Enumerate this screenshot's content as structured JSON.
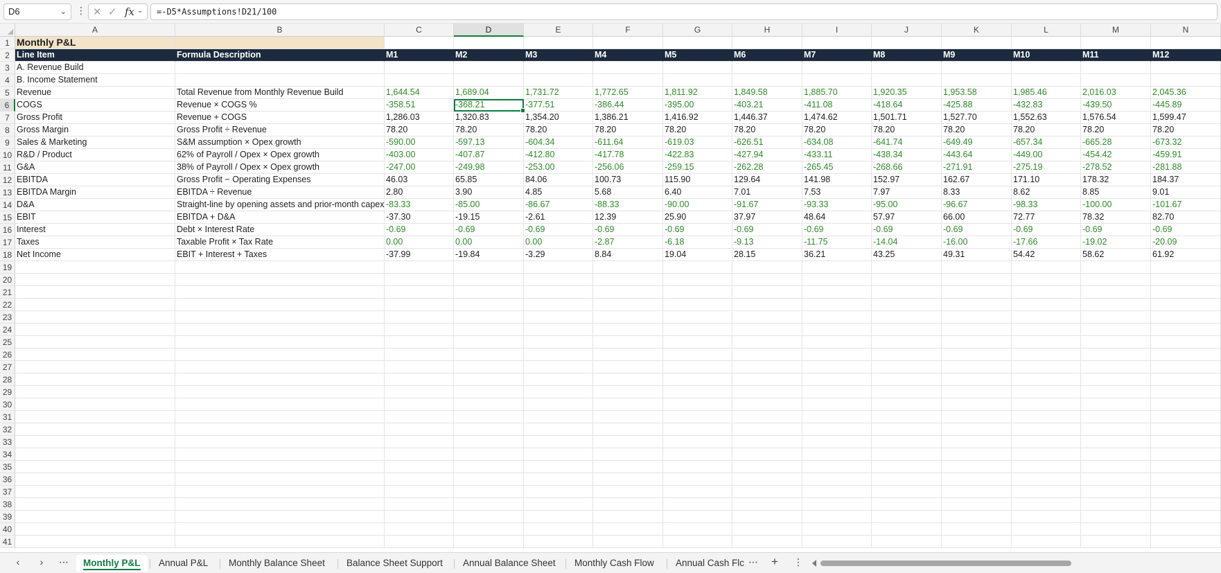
{
  "formula_bar": {
    "cell_ref": "D6",
    "formula": "=-D5*Assumptions!D21/100",
    "fx_label": "fx"
  },
  "columns": [
    "A",
    "B",
    "C",
    "D",
    "E",
    "F",
    "G",
    "H",
    "I",
    "J",
    "K",
    "L",
    "M",
    "N"
  ],
  "selected_cell": {
    "col": "D",
    "row": 6
  },
  "title": "Monthly P&L",
  "header": [
    "Line Item",
    "Formula Description",
    "M1",
    "M2",
    "M3",
    "M4",
    "M5",
    "M6",
    "M7",
    "M8",
    "M9",
    "M10",
    "M11",
    "M12"
  ],
  "rows": [
    {
      "label": "A. Revenue Build",
      "desc": "",
      "values": [],
      "green": false
    },
    {
      "label": "B. Income Statement",
      "desc": "",
      "values": [],
      "green": false
    },
    {
      "label": "Revenue",
      "desc": "Total Revenue from Monthly Revenue Build",
      "values": [
        "1,644.54",
        "1,689.04",
        "1,731.72",
        "1,772.65",
        "1,811.92",
        "1,849.58",
        "1,885.70",
        "1,920.35",
        "1,953.58",
        "1,985.46",
        "2,016.03",
        "2,045.36"
      ],
      "green": true
    },
    {
      "label": "COGS",
      "desc": "Revenue × COGS %",
      "values": [
        "-358.51",
        "-368.21",
        "-377.51",
        "-386.44",
        "-395.00",
        "-403.21",
        "-411.08",
        "-418.64",
        "-425.88",
        "-432.83",
        "-439.50",
        "-445.89"
      ],
      "green": true
    },
    {
      "label": "Gross Profit",
      "desc": "Revenue + COGS",
      "values": [
        "1,286.03",
        "1,320.83",
        "1,354.20",
        "1,386.21",
        "1,416.92",
        "1,446.37",
        "1,474.62",
        "1,501.71",
        "1,527.70",
        "1,552.63",
        "1,576.54",
        "1,599.47"
      ],
      "green": false
    },
    {
      "label": "Gross Margin",
      "desc": "Gross Profit ÷ Revenue",
      "values": [
        "78.20",
        "78.20",
        "78.20",
        "78.20",
        "78.20",
        "78.20",
        "78.20",
        "78.20",
        "78.20",
        "78.20",
        "78.20",
        "78.20"
      ],
      "green": false
    },
    {
      "label": "Sales & Marketing",
      "desc": "S&M assumption × Opex growth",
      "values": [
        "-590.00",
        "-597.13",
        "-604.34",
        "-611.64",
        "-619.03",
        "-626.51",
        "-634.08",
        "-641.74",
        "-649.49",
        "-657.34",
        "-665.28",
        "-673.32"
      ],
      "green": true
    },
    {
      "label": "R&D / Product",
      "desc": "62% of Payroll / Opex × Opex growth",
      "values": [
        "-403.00",
        "-407.87",
        "-412.80",
        "-417.78",
        "-422.83",
        "-427.94",
        "-433.11",
        "-438.34",
        "-443.64",
        "-449.00",
        "-454.42",
        "-459.91"
      ],
      "green": true
    },
    {
      "label": "G&A",
      "desc": "38% of Payroll / Opex × Opex growth",
      "values": [
        "-247.00",
        "-249.98",
        "-253.00",
        "-256.06",
        "-259.15",
        "-262.28",
        "-265.45",
        "-268.66",
        "-271.91",
        "-275.19",
        "-278.52",
        "-281.88"
      ],
      "green": true
    },
    {
      "label": "EBITDA",
      "desc": "Gross Profit − Operating Expenses",
      "values": [
        "46.03",
        "65.85",
        "84.06",
        "100.73",
        "115.90",
        "129.64",
        "141.98",
        "152.97",
        "162.67",
        "171.10",
        "178.32",
        "184.37"
      ],
      "green": false
    },
    {
      "label": "EBITDA Margin",
      "desc": "EBITDA ÷ Revenue",
      "values": [
        "2.80",
        "3.90",
        "4.85",
        "5.68",
        "6.40",
        "7.01",
        "7.53",
        "7.97",
        "8.33",
        "8.62",
        "8.85",
        "9.01"
      ],
      "green": false
    },
    {
      "label": "D&A",
      "desc": "Straight-line by opening assets and prior-month capex",
      "values": [
        "-83.33",
        "-85.00",
        "-86.67",
        "-88.33",
        "-90.00",
        "-91.67",
        "-93.33",
        "-95.00",
        "-96.67",
        "-98.33",
        "-100.00",
        "-101.67"
      ],
      "green": true
    },
    {
      "label": "EBIT",
      "desc": "EBITDA + D&A",
      "values": [
        "-37.30",
        "-19.15",
        "-2.61",
        "12.39",
        "25.90",
        "37.97",
        "48.64",
        "57.97",
        "66.00",
        "72.77",
        "78.32",
        "82.70"
      ],
      "green": false
    },
    {
      "label": "Interest",
      "desc": "Debt × Interest Rate",
      "values": [
        "-0.69",
        "-0.69",
        "-0.69",
        "-0.69",
        "-0.69",
        "-0.69",
        "-0.69",
        "-0.69",
        "-0.69",
        "-0.69",
        "-0.69",
        "-0.69"
      ],
      "green": true
    },
    {
      "label": "Taxes",
      "desc": "Taxable Profit × Tax Rate",
      "values": [
        "0.00",
        "0.00",
        "0.00",
        "-2.87",
        "-6.18",
        "-9.13",
        "-11.75",
        "-14.04",
        "-16.00",
        "-17.66",
        "-19.02",
        "-20.09"
      ],
      "green": true
    },
    {
      "label": "Net Income",
      "desc": "EBIT + Interest + Taxes",
      "values": [
        "-37.99",
        "-19.84",
        "-3.29",
        "8.84",
        "19.04",
        "28.15",
        "36.21",
        "43.25",
        "49.31",
        "54.42",
        "58.62",
        "61.92"
      ],
      "green": false
    }
  ],
  "row_count": 41,
  "sheet_tabs": [
    "Monthly P&L",
    "Annual P&L",
    "Monthly Balance Sheet",
    "Balance Sheet Support",
    "Annual Balance Sheet",
    "Monthly Cash Flow",
    "Annual Cash Flc"
  ],
  "active_tab": "Monthly P&L",
  "icons": {
    "prev": "‹",
    "next": "›",
    "more": "⋯",
    "add": "+",
    "vdots": "⋮",
    "x": "✕",
    "check": "✓",
    "chev": "⌄"
  },
  "colors": {
    "header_bg": "#1b2a3d",
    "title_bg": "#f2e3c9",
    "input_green": "#2e8b28",
    "accent": "#107c41"
  }
}
